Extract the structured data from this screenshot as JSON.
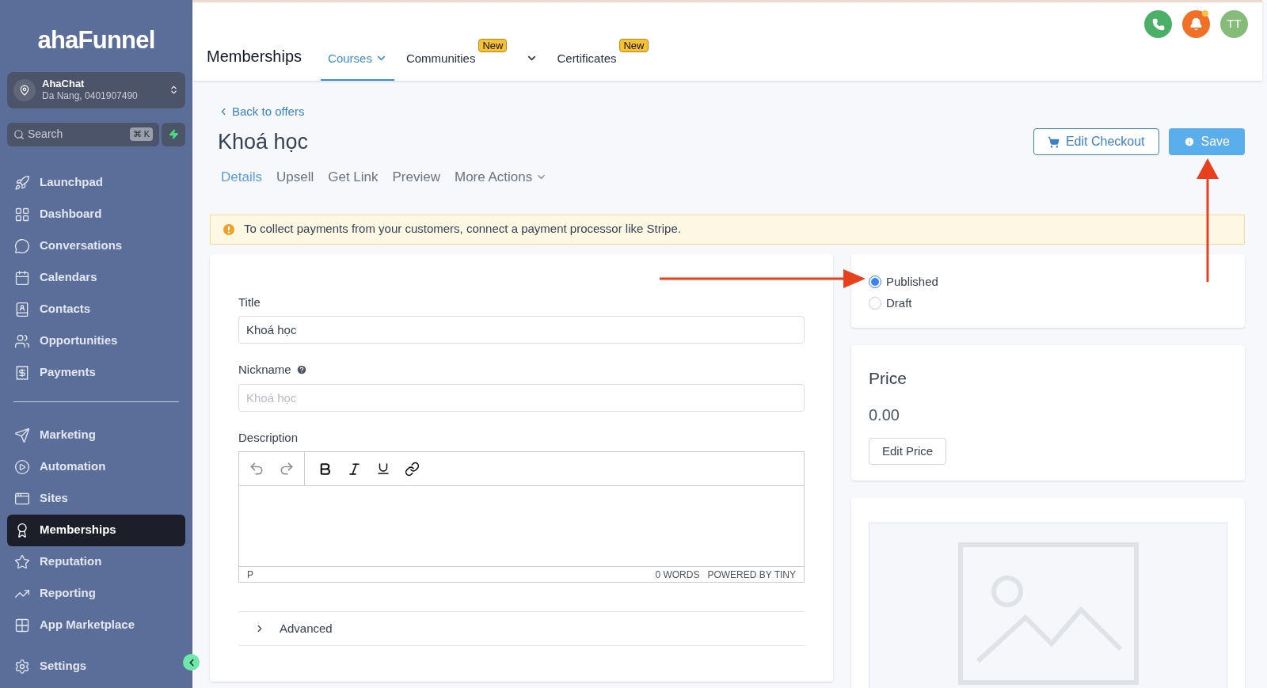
{
  "sidebar": {
    "logo": "ahaFunnel",
    "account": {
      "name": "AhaChat",
      "detail": "Da Nang, 0401907490"
    },
    "search": {
      "placeholder": "Search",
      "shortcut": "⌘ K"
    },
    "groups": [
      [
        {
          "label": "Launchpad",
          "selected": false
        },
        {
          "label": "Dashboard",
          "selected": false
        },
        {
          "label": "Conversations",
          "selected": false
        },
        {
          "label": "Calendars",
          "selected": false
        },
        {
          "label": "Contacts",
          "selected": false
        },
        {
          "label": "Opportunities",
          "selected": false
        },
        {
          "label": "Payments",
          "selected": false
        }
      ],
      [
        {
          "label": "Marketing",
          "selected": false
        },
        {
          "label": "Automation",
          "selected": false
        },
        {
          "label": "Sites",
          "selected": false
        },
        {
          "label": "Memberships",
          "selected": true
        },
        {
          "label": "Reputation",
          "selected": false
        },
        {
          "label": "Reporting",
          "selected": false
        },
        {
          "label": "App Marketplace",
          "selected": false
        }
      ],
      [
        {
          "label": "Settings",
          "selected": false
        }
      ]
    ]
  },
  "header": {
    "title": "Memberships",
    "avatar": "TT",
    "notification_dot": true,
    "tabs": [
      {
        "label": "Courses",
        "selected": true,
        "dropdown": true
      },
      {
        "label": "Communities",
        "selected": false,
        "badge": "New"
      },
      {
        "selected": false,
        "dropdown": true
      },
      {
        "label": "Certificates",
        "selected": false,
        "badge": "New"
      }
    ]
  },
  "page": {
    "back_link": "Back to offers",
    "title": "Khoá học",
    "subtabs": [
      {
        "label": "Details",
        "selected": true
      },
      {
        "label": "Upsell",
        "selected": false
      },
      {
        "label": "Get Link",
        "selected": false
      },
      {
        "label": "Preview",
        "selected": false
      },
      {
        "label": "More Actions",
        "selected": false,
        "dropdown": true
      }
    ],
    "buttons": [
      {
        "label": "Edit Checkout",
        "kind": "outline"
      },
      {
        "label": "Save",
        "kind": "primary"
      }
    ],
    "alert": "To collect payments from your customers, connect a payment processor like Stripe.",
    "form": {
      "title_label": "Title",
      "title_value": "Khoá học",
      "nickname_label": "Nickname",
      "nickname_placeholder": "Khoá học",
      "description_label": "Description",
      "editor": {
        "path": "P",
        "word_count": "0 WORDS",
        "branding": "POWERED BY TINY"
      },
      "advanced": {
        "label": "Advanced",
        "expanded": false
      }
    },
    "status": [
      {
        "label": "Published",
        "selected": true
      },
      {
        "label": "Draft",
        "selected": false
      }
    ],
    "price": {
      "title": "Price",
      "value": "0.00",
      "button": "Edit Price"
    },
    "image": {
      "kind": "placeholder"
    }
  }
}
